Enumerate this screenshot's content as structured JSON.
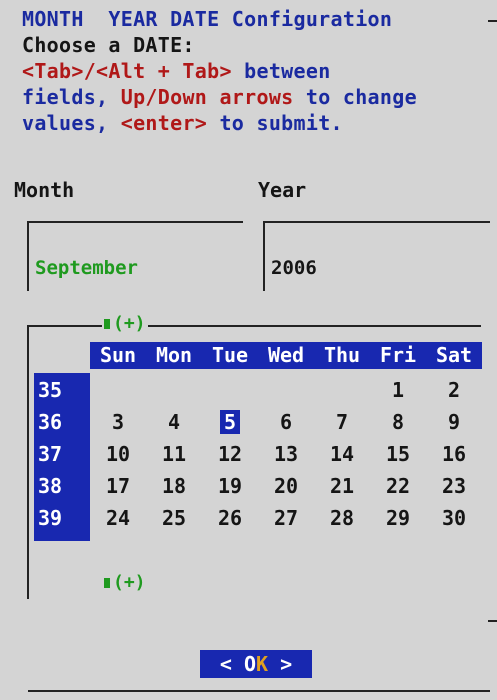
{
  "header": {
    "title": "MONTH  YEAR DATE Configuration",
    "instruction": "Choose a DATE:",
    "help": {
      "keys1": "<Tab>/<Alt + Tab>",
      "text1": " between",
      "text2": "fields, ",
      "keys2": "Up/Down arrows",
      "text3": " to change",
      "text4": "values, ",
      "keys3": "<enter>",
      "text5": " to submit."
    }
  },
  "fields": {
    "month_label": "Month",
    "year_label": "Year",
    "month_value": "September",
    "year_value": "2006"
  },
  "calendar": {
    "expand_top": "(+)",
    "expand_bottom": "(+)",
    "weekdays": [
      "Sun",
      "Mon",
      "Tue",
      "Wed",
      "Thu",
      "Fri",
      "Sat"
    ],
    "weeks": [
      "35",
      "36",
      "37",
      "38",
      "39"
    ],
    "days": [
      [
        "",
        "",
        "",
        "",
        "",
        "1",
        "2"
      ],
      [
        "3",
        "4",
        "5",
        "6",
        "7",
        "8",
        "9"
      ],
      [
        "10",
        "11",
        "12",
        "13",
        "14",
        "15",
        "16"
      ],
      [
        "17",
        "18",
        "19",
        "20",
        "21",
        "22",
        "23"
      ],
      [
        "24",
        "25",
        "26",
        "27",
        "28",
        "29",
        "30"
      ]
    ],
    "selected_day": "5"
  },
  "ok_button": {
    "left_arrow": "<",
    "o": " O",
    "k": "K",
    "right_arrow": " >"
  },
  "colors": {
    "background": "#d4d4d4",
    "highlight": "#1828b0",
    "accent_green": "#1f9a1f",
    "key_red": "#b01818",
    "text_blue": "#1a2aa0"
  }
}
